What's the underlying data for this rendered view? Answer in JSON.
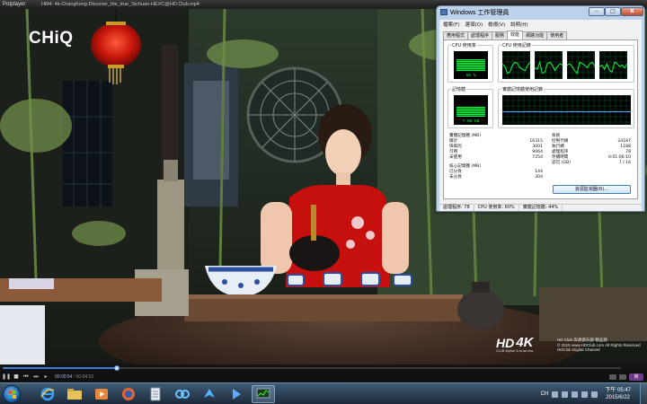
{
  "player": {
    "app_name": "Potplayer",
    "file_title": "HM4: 4k-Changhong-Discover_the_true_Sichuan-HEVC@HD.Club.mp4",
    "progress": 0.185,
    "time_current": "00:00:54",
    "time_separator": "/",
    "time_total": "00:04:52",
    "badge": "常"
  },
  "video": {
    "brand_logo": "CHiQ",
    "watermark_hd": "HD",
    "watermark_4k": "4K",
    "watermark_sub": "CLUB   digital & business",
    "watermark_note_line1": "HD Club 高清俱乐部·精品源",
    "watermark_note_line2": "© 2015 www.HDClub.com All Rights Reserved",
    "watermark_note_line3": "HDClub Digital Channel"
  },
  "task_manager": {
    "title": "Windows 工作管理員",
    "buttons": {
      "minimize": "–",
      "maximize": "□",
      "close": "X"
    },
    "menu": [
      "檔案(F)",
      "選項(O)",
      "檢視(V)",
      "說明(H)"
    ],
    "tabs": [
      "應用程式",
      "處理程序",
      "服務",
      "效能",
      "網路功能",
      "使用者"
    ],
    "active_tab": 3,
    "cpu_usage_label": "CPU 使用率",
    "cpu_usage_value": "60 %",
    "cpu_usage_fraction": 0.6,
    "cpu_history_label": "CPU 使用記錄",
    "memory_label": "記憶體",
    "memory_value": "7.06 GB",
    "memory_fraction": 0.44,
    "memory_history_label": "實體記憶體使用記錄",
    "physical_memory": {
      "header": "實體記憶體 (MB)",
      "rows": [
        {
          "label": "總計",
          "value": "16315"
        },
        {
          "label": "快取的",
          "value": "3001"
        },
        {
          "label": "可用",
          "value": "9064"
        },
        {
          "label": "未使用",
          "value": "7254"
        }
      ]
    },
    "kernel_memory": {
      "header": "核心記憶體 (MB)",
      "rows": [
        {
          "label": "已分頁",
          "value": "144"
        },
        {
          "label": "未分頁",
          "value": "304"
        }
      ]
    },
    "system": {
      "header": "系統",
      "rows": [
        {
          "label": "控制代碼",
          "value": "24187"
        },
        {
          "label": "執行緒",
          "value": "1188"
        },
        {
          "label": "處理程序",
          "value": "78"
        },
        {
          "label": "存續時間",
          "value": "0:01:06:10"
        },
        {
          "label": "認可 (GB)",
          "value": "7 / 16"
        }
      ]
    },
    "resource_monitor_button": "資源監視器(R)...",
    "status_bar": {
      "processes": "處理程序: 78",
      "cpu": "CPU 使用率: 60%",
      "memory": "實體記憶體: 44%"
    }
  },
  "taskbar": {
    "language": "CH",
    "time": "下午 05:47",
    "date": "2015/6/22",
    "apps": [
      "ie-icon",
      "folder-icon",
      "media-player-icon",
      "firefox-icon",
      "document-icon",
      "network-icon",
      "bird-icon",
      "play-icon",
      "task-manager-icon"
    ],
    "active_app": 8
  }
}
